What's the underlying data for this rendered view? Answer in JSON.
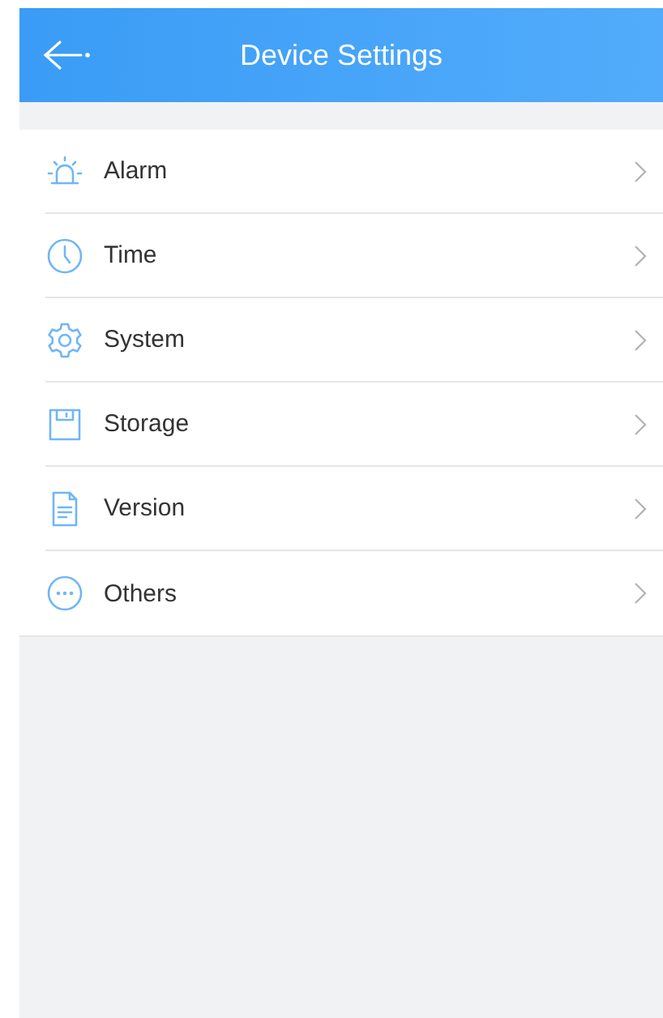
{
  "header": {
    "title": "Device Settings"
  },
  "items": [
    {
      "label": "Alarm",
      "kind": "alarm"
    },
    {
      "label": "Time",
      "kind": "clock"
    },
    {
      "label": "System",
      "kind": "gear"
    },
    {
      "label": "Storage",
      "kind": "disk"
    },
    {
      "label": "Version",
      "kind": "document"
    },
    {
      "label": "Others",
      "kind": "more"
    }
  ]
}
